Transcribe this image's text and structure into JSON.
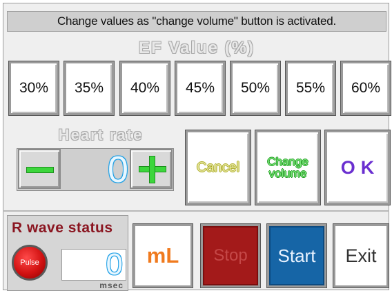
{
  "banner": {
    "text": "Change values as \"change volume\" button is activated."
  },
  "ef": {
    "title": "EF Value (%)",
    "options": [
      "30%",
      "35%",
      "40%",
      "45%",
      "50%",
      "55%",
      "60%"
    ]
  },
  "heart_rate": {
    "title": "Heart rate",
    "value": "0"
  },
  "actions": {
    "cancel": "Cancel",
    "change_volume_line1": "Change",
    "change_volume_line2": "volume",
    "ok": "OK"
  },
  "r_wave": {
    "title": "R wave status",
    "pulse_label": "Pulse",
    "value": "0",
    "unit": "msec"
  },
  "bottom": {
    "ml": "mL",
    "stop": "Stop",
    "start": "Start",
    "exit": "Exit"
  },
  "colors": {
    "accent_green": "#3cd63c",
    "stop_red": "#a31a1a",
    "start_blue": "#1665a6",
    "ml_orange": "#f07a1e",
    "ok_purple": "#6a2fd0"
  }
}
